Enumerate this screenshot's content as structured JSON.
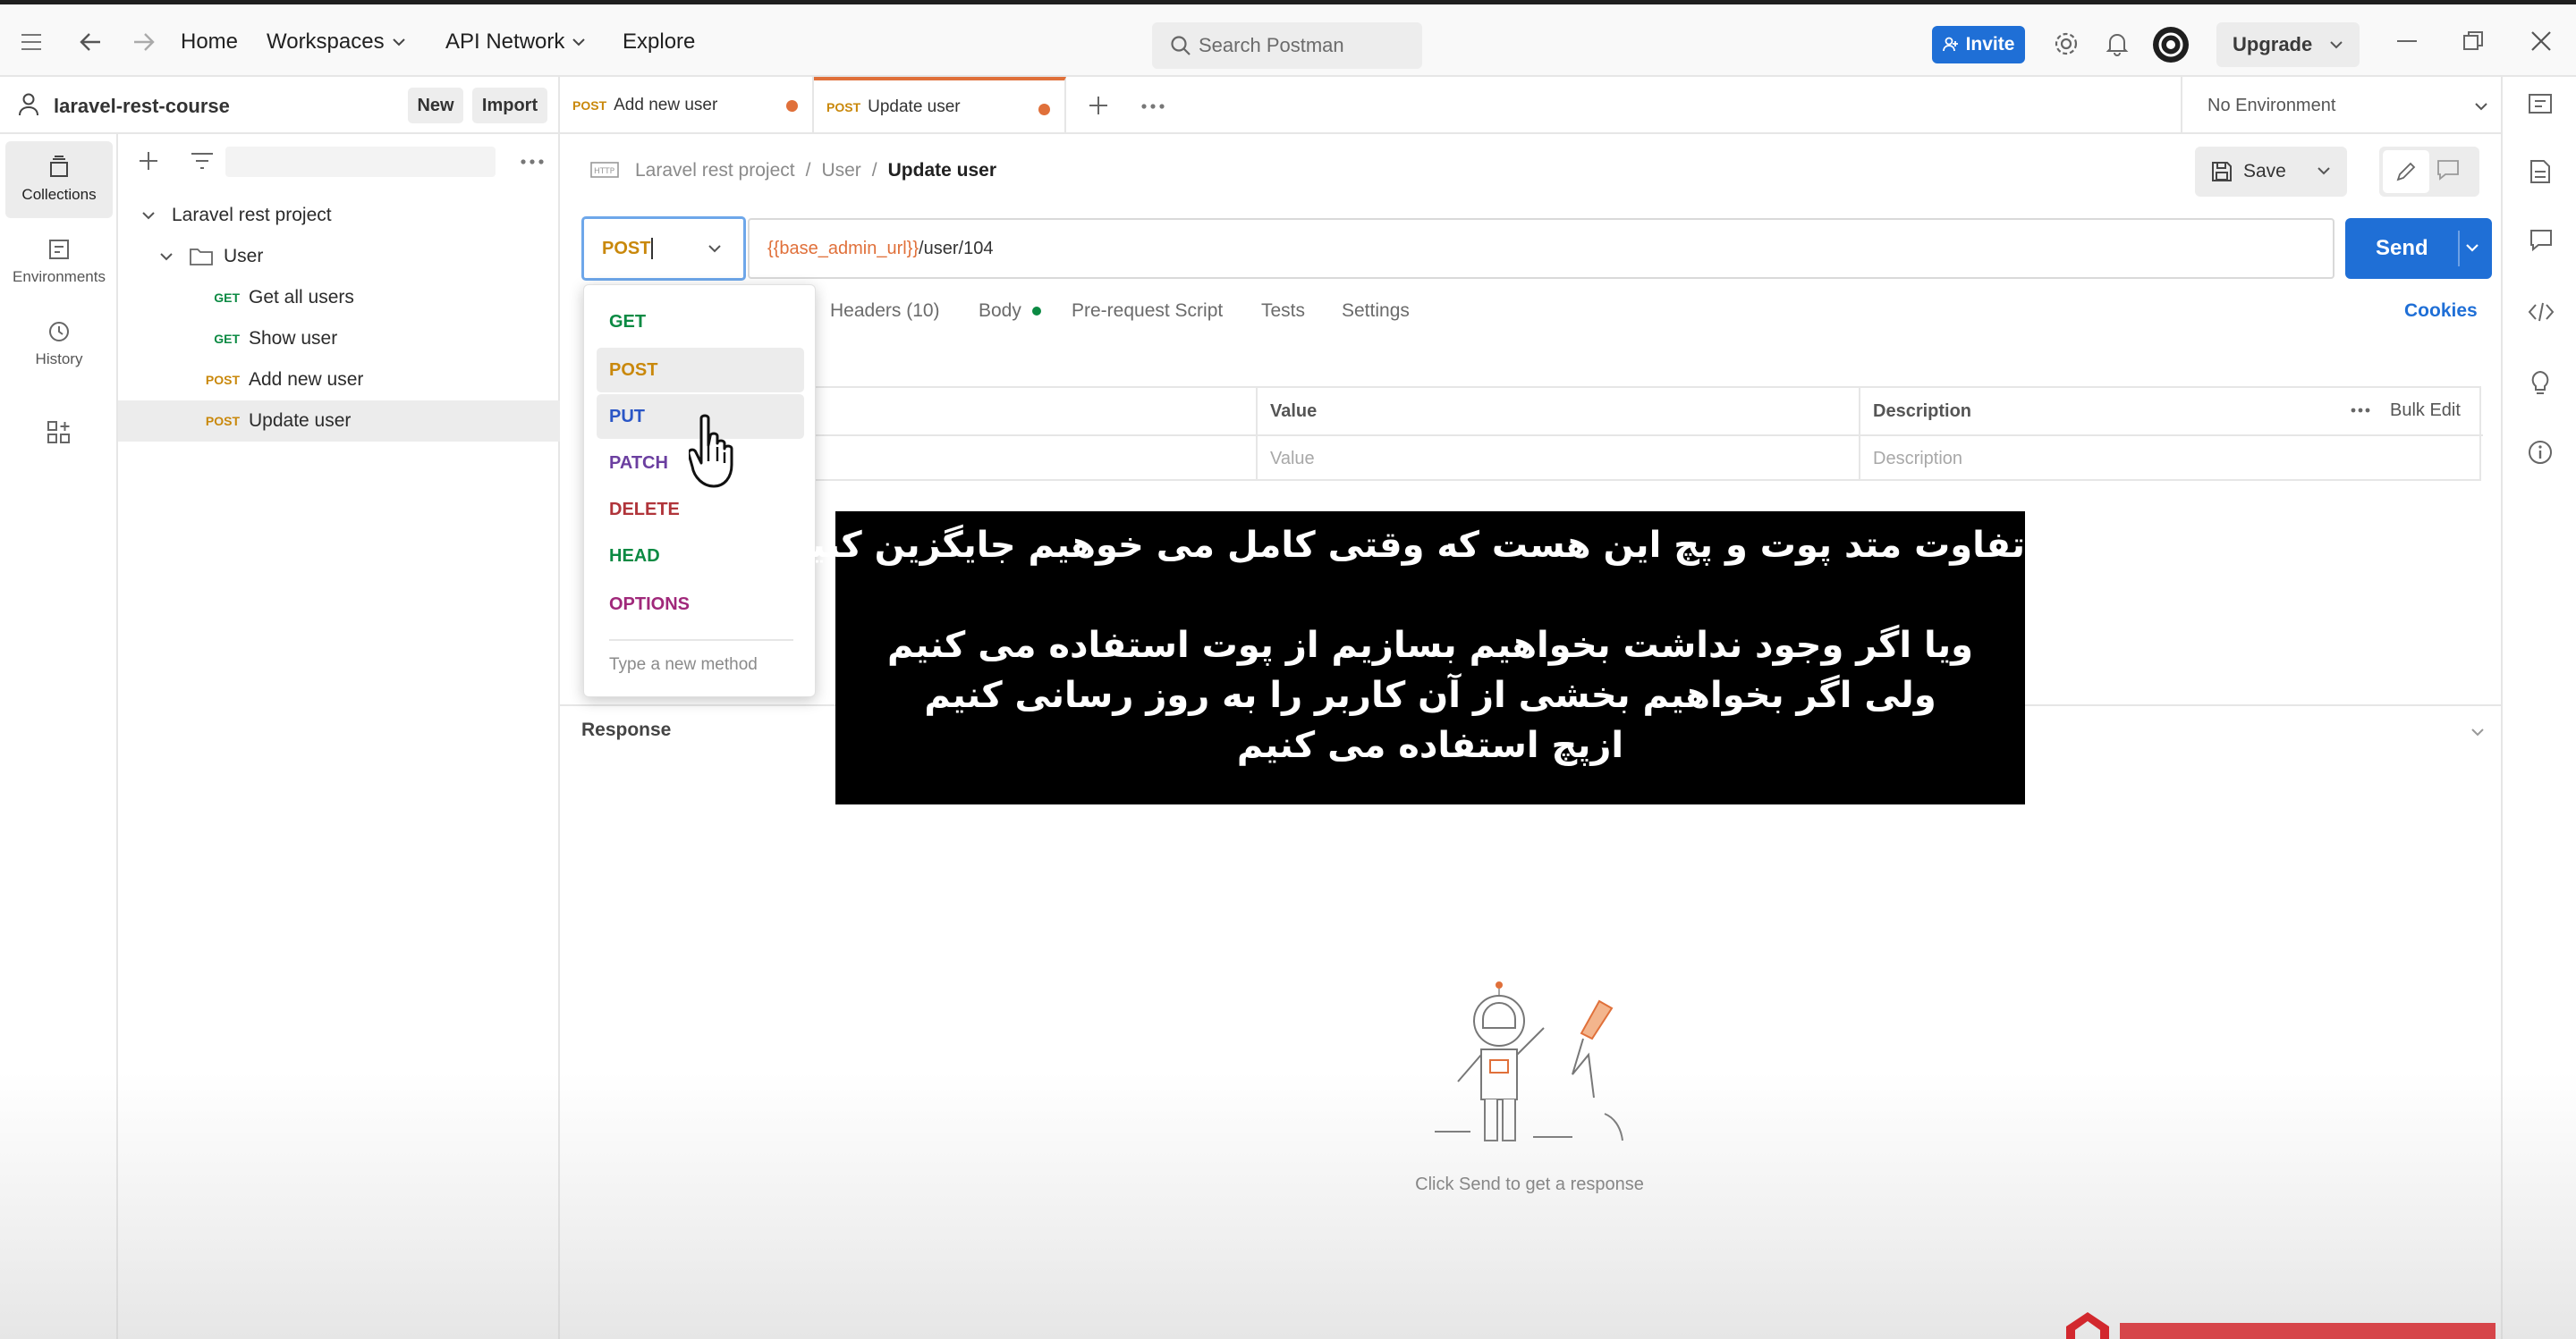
{
  "topbar": {
    "home": "Home",
    "workspaces": "Workspaces",
    "api_network": "API Network",
    "explore": "Explore",
    "search_placeholder": "Search Postman",
    "invite": "Invite",
    "upgrade": "Upgrade"
  },
  "workspace": {
    "name": "laravel-rest-course",
    "new_label": "New",
    "import_label": "Import"
  },
  "rail": {
    "collections": "Collections",
    "environments": "Environments",
    "history": "History"
  },
  "tree": {
    "collection": "Laravel rest project",
    "folder": "User",
    "items": [
      {
        "method": "GET",
        "name": "Get all users"
      },
      {
        "method": "GET",
        "name": "Show user"
      },
      {
        "method": "POST",
        "name": "Add new user"
      },
      {
        "method": "POST",
        "name": "Update user"
      }
    ]
  },
  "tabs": [
    {
      "method": "POST",
      "name": "Add new user"
    },
    {
      "method": "POST",
      "name": "Update user"
    }
  ],
  "environment": "No Environment",
  "breadcrumb": {
    "root": "Laravel rest project",
    "folder": "User",
    "current": "Update user",
    "sep": "/"
  },
  "toolbar": {
    "save": "Save"
  },
  "request": {
    "method": "POST",
    "url_var": "{{base_admin_url}}",
    "url_path": "/user/104",
    "send": "Send"
  },
  "subtabs": {
    "headers": "Headers (10)",
    "body": "Body",
    "prerequest": "Pre-request Script",
    "tests": "Tests",
    "settings": "Settings",
    "cookies": "Cookies"
  },
  "params_table": {
    "col_value": "Value",
    "col_description": "Description",
    "bulk_edit": "Bulk Edit",
    "placeholder_value": "Value",
    "placeholder_description": "Description"
  },
  "method_menu": {
    "items": [
      "GET",
      "POST",
      "PUT",
      "PATCH",
      "DELETE",
      "HEAD",
      "OPTIONS"
    ],
    "highlighted": [
      "POST",
      "PUT"
    ],
    "new_placeholder": "Type a new method"
  },
  "response": {
    "title": "Response",
    "empty": "Click Send to get a response"
  },
  "subtitle": {
    "line1": "تفاوت متد پوت و پچ این هست که وقتی کامل می خوهیم جایگزین کنیم",
    "line2": "ویا اگر وجود نداشت بخواهیم بسازیم از پوت استفاده می کنیم",
    "line3": "ولی اگر بخواهیم بخشی از آن کاربر را به روز رسانی کنیم",
    "line4": "ازپچ استفاده می کنیم"
  },
  "colors": {
    "accent": "#1f6fd6",
    "post": "#c9880b",
    "get": "#0b8a43",
    "put": "#2a56c6",
    "unsaved_dot": "#e0703a"
  }
}
